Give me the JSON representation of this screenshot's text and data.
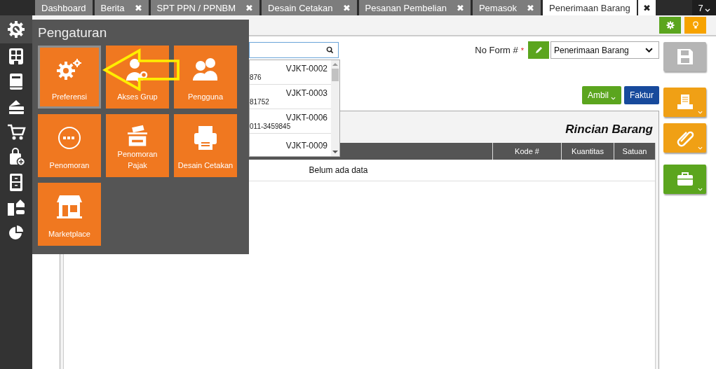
{
  "tabs": [
    {
      "label": "Dashboard",
      "closable": false,
      "selected": false
    },
    {
      "label": "Berita",
      "closable": true,
      "selected": false
    },
    {
      "label": "SPT PPN / PPNBM",
      "closable": true,
      "selected": false
    },
    {
      "label": "Desain Cetakan",
      "closable": true,
      "selected": false
    },
    {
      "label": "Pesanan Pembelian",
      "closable": true,
      "selected": false
    },
    {
      "label": "Pemasok",
      "closable": true,
      "selected": false
    },
    {
      "label": "Penerimaan Barang",
      "closable": true,
      "selected": true
    }
  ],
  "close_glyph": "✖",
  "tab_count": "7",
  "sidebar": {
    "items": [
      {
        "kind": "gear",
        "selected": true
      },
      {
        "kind": "building",
        "selected": false
      },
      {
        "kind": "book",
        "selected": false
      },
      {
        "kind": "wallet",
        "selected": false
      },
      {
        "kind": "cart",
        "selected": false
      },
      {
        "kind": "bag",
        "selected": false
      },
      {
        "kind": "cabinet",
        "selected": false
      },
      {
        "kind": "buildings",
        "selected": false
      },
      {
        "kind": "pie-chart",
        "selected": false
      }
    ]
  },
  "search_results": [
    {
      "code": "VJKT-0002",
      "detail": "876"
    },
    {
      "code": "VJKT-0003",
      "detail": "81752"
    },
    {
      "code": "VJKT-0006",
      "detail": "011-3459845"
    },
    {
      "code": "VJKT-0009"
    }
  ],
  "form_number": {
    "label": "No Form #",
    "required": "*",
    "value": "Penerimaan Barang"
  },
  "actions": [
    {
      "label": "Ambil",
      "dropdown": true,
      "color": "#5ba51e"
    },
    {
      "label": "Faktur",
      "dropdown": false,
      "color": "#174a9c"
    }
  ],
  "details": {
    "title": "Rincian Barang",
    "columns": [
      "Kode #",
      "Kuantitas",
      "Satuan"
    ],
    "empty_text": "Belum ada data"
  },
  "side_buttons": [
    {
      "kind": "save",
      "dropdown": false,
      "color": "#b5b5b5"
    },
    {
      "kind": "printer",
      "dropdown": true,
      "color": "#f0a015"
    },
    {
      "kind": "paperclip",
      "dropdown": true,
      "color": "#f0a015"
    },
    {
      "kind": "briefcase",
      "dropdown": true,
      "color": "#5ba51e"
    }
  ],
  "settings_menu": {
    "title": "Pengaturan",
    "tiles": [
      {
        "label": "Preferensi",
        "kind": "gears",
        "selected": true
      },
      {
        "label": "Akses Grup",
        "kind": "user-key",
        "selected": false
      },
      {
        "label": "Pengguna",
        "kind": "users",
        "selected": false
      },
      {
        "label": "Penomoran",
        "kind": "numbering",
        "selected": false
      },
      {
        "label": "Penomoran Pajak",
        "kind": "tax",
        "selected": false
      },
      {
        "label": "Desain Cetakan",
        "kind": "printer",
        "selected": false
      },
      {
        "label": "Marketplace",
        "kind": "store",
        "selected": false
      }
    ]
  }
}
